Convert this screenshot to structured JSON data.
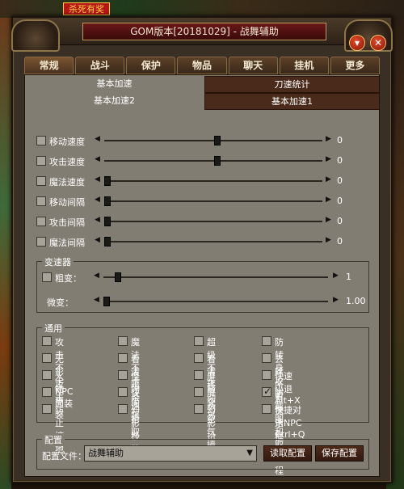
{
  "background": {
    "banner_text": "杀死有奖"
  },
  "window": {
    "title": "GOM版本[20181029] - 战舞辅助"
  },
  "tabs": [
    "常规",
    "战斗",
    "保护",
    "物品",
    "聊天",
    "挂机",
    "更多"
  ],
  "subtabs": {
    "left_top": "基本加速",
    "left_bottom": "基本加速2",
    "right_top": "刀速统计",
    "right_bottom": "基本加速1"
  },
  "speed_rows": [
    {
      "label": "移动速度",
      "checked": false,
      "value": "0",
      "level": 0.52
    },
    {
      "label": "攻击速度",
      "checked": false,
      "value": "0",
      "level": 0.52
    },
    {
      "label": "魔法速度",
      "checked": false,
      "value": "0",
      "level": 0.0
    },
    {
      "label": "移动间隔",
      "checked": false,
      "value": "0",
      "level": 0.0
    },
    {
      "label": "攻击间隔",
      "checked": false,
      "value": "0",
      "level": 0.0
    },
    {
      "label": "魔法间隔",
      "checked": false,
      "value": "0",
      "level": 0.0
    }
  ],
  "speed_changer": {
    "title": "变速器",
    "coarse": {
      "label": "粗变：",
      "checked": false,
      "value": "1",
      "level": 0.05
    },
    "fine": {
      "label": "微变：",
      "value": "1.00",
      "level": 0.0
    }
  },
  "general": {
    "title": "通用",
    "options": [
      [
        {
          "label": "攻击不卡",
          "checked": false
        },
        {
          "label": "魔法不卡",
          "checked": false
        },
        {
          "label": "超级不卡",
          "checked": false
        },
        {
          "label": "防转身攻击",
          "checked": false
        }
      ],
      [
        {
          "label": "无影攻击",
          "checked": false
        },
        {
          "label": "看清暗杀",
          "checked": false
        },
        {
          "label": "看清移动",
          "checked": false
        },
        {
          "label": "去除所有提示框",
          "checked": false
        }
      ],
      [
        {
          "label": "人物简装",
          "checked": false
        },
        {
          "label": "怪物简装",
          "checked": false
        },
        {
          "label": "屏蔽交易",
          "checked": false
        },
        {
          "label": "快速小退 Alt+X",
          "checked": false
        }
      ],
      [
        {
          "label": "NPC简装",
          "checked": false
        },
        {
          "label": "快速拾取",
          "checked": false
        },
        {
          "label": "屏蔽空气墙",
          "checked": false
        },
        {
          "label": "防截图和取进程",
          "checked": true
        }
      ],
      [
        {
          "label": "防止挖地",
          "checked": false
        },
        {
          "label": "幻影移动",
          "checked": false
        },
        {
          "label": "幻影拾取",
          "checked": false
        },
        {
          "label": "快捷对话NPC Ctrl+Q",
          "checked": false
        }
      ]
    ]
  },
  "config": {
    "title": "配置",
    "file_label": "配置文件：",
    "file_value": "战舞辅助",
    "read_button": "读取配置",
    "save_button": "保存配置"
  }
}
